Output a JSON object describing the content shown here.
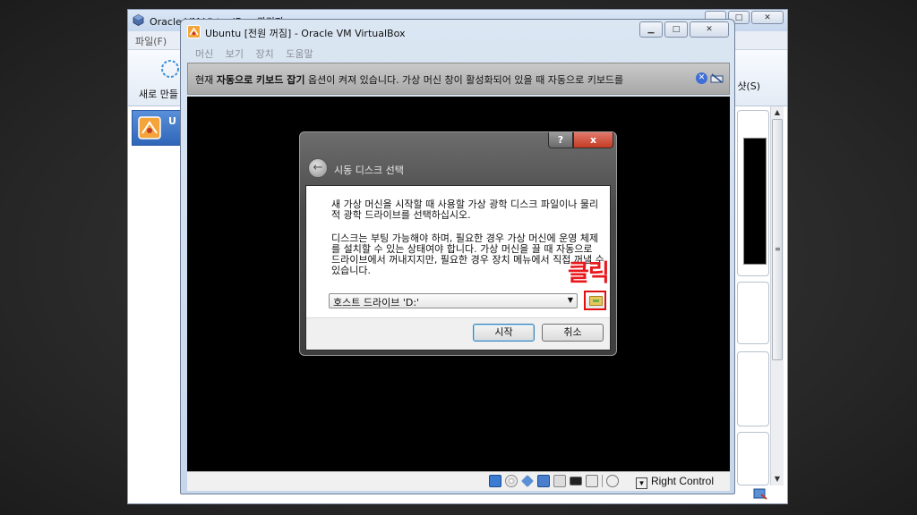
{
  "manager": {
    "title": "Oracle VM VirtualBox 관리자",
    "menu_file": "파일(F)",
    "toolbar_new": "새로 만들",
    "toolbar_snapshot": "샷(S)",
    "vm_item_initial": "U"
  },
  "vm_window": {
    "title": "Ubuntu [전원 꺼짐] - Oracle VM VirtualBox",
    "menu": [
      "머신",
      "보기",
      "장치",
      "도움말"
    ],
    "notice_prefix": "현재 ",
    "notice_bold": "자동으로 키보드 잡기",
    "notice_suffix": " 옵션이 켜져 있습니다. 가상 머신 창이 활성화되어 있을 때 자동으로 키보드를",
    "host_key": "Right Control"
  },
  "dialog": {
    "help_glyph": "?",
    "close_glyph": "x",
    "title": "시동 디스크 선택",
    "paragraph1": "새 가상 머신을 시작할 때 사용할 가상 광학 디스크 파일이나 물리적 광학 드라이브를 선택하십시오.",
    "paragraph2": "디스크는 부팅 가능해야 하며, 필요한 경우 가상 머신에 운영 체제를 설치할 수 있는 상태여야 합니다. 가상 머신을 끌 때 자동으로 드라이브에서 꺼내지지만, 필요한 경우 장치 메뉴에서 직접 꺼낼 수 있습니다.",
    "drive_selected": "호스트 드라이브 'D:'",
    "start_button": "시작",
    "cancel_button": "취소"
  },
  "annotation": "클릭",
  "colors": {
    "annotation_red": "#e8181d",
    "dialog_close_red": "#c53a24",
    "title_bar_blue": "#c6d7ee"
  }
}
